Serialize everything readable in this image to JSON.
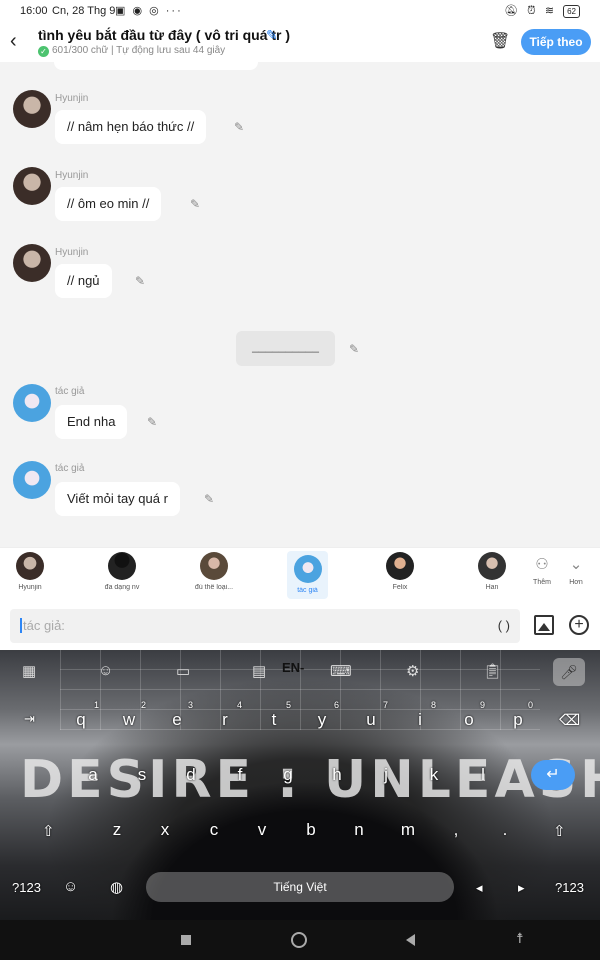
{
  "status_bar": {
    "time": "16:00",
    "date": "Cn, 28 Thg 9",
    "left_icons": "▣ ◉ ◎ ···",
    "right_icons": [
      "bell-off",
      "alarm",
      "wifi"
    ],
    "battery": "62"
  },
  "header": {
    "title": "tình yêu bắt đầu từ đây ( vô tri quá tr )",
    "subtitle": "601/300 chữ | Tự động lưu sau 44 giây",
    "next_label": "Tiếp theo"
  },
  "messages": [
    {
      "sender": "Hyunjin",
      "text": "// nâm hẹn báo thức //"
    },
    {
      "sender": "Hyunjin",
      "text": "// ôm eo min //"
    },
    {
      "sender": "Hyunjin",
      "text": "// ngủ"
    },
    {
      "sender": "",
      "text": "__________"
    },
    {
      "sender": "tác giả",
      "text": "End nha"
    },
    {
      "sender": "tác giả",
      "text": "Viết mỏi tay quá r"
    }
  ],
  "characters": [
    {
      "name": "Hyunjin"
    },
    {
      "name": "đa dạng nv"
    },
    {
      "name": "đủ thể loại..."
    },
    {
      "name": "tác giả",
      "selected": true
    },
    {
      "name": "Felix"
    },
    {
      "name": "Han"
    }
  ],
  "char_actions": {
    "more": "Thêm",
    "less": "Hơn"
  },
  "input": {
    "placeholder": "tác giả:",
    "paren": "( )"
  },
  "keyboard": {
    "banner": "DESIRE : UNLEASH",
    "logo": "EN-",
    "row1": [
      "q",
      "w",
      "e",
      "r",
      "t",
      "y",
      "u",
      "i",
      "o",
      "p"
    ],
    "row1_nums": [
      "1",
      "2",
      "3",
      "4",
      "5",
      "6",
      "7",
      "8",
      "9",
      "0"
    ],
    "row2": [
      "a",
      "s",
      "d",
      "f",
      "g",
      "h",
      "j",
      "k",
      "l"
    ],
    "row3": [
      "z",
      "x",
      "c",
      "v",
      "b",
      "n",
      "m",
      ",",
      "."
    ],
    "left_func": "?123",
    "right_func": "?123",
    "space_label": "Tiếng Việt",
    "tab_glyph": "⇥",
    "backspace_glyph": "⌫",
    "shift_glyph": "⇧",
    "enter_glyph": "↵",
    "emoji_glyph": "☺",
    "globe_glyph": "◍",
    "left_arrow": "◂",
    "right_arrow": "▸"
  },
  "colors": {
    "accent": "#4a9df5",
    "check": "#4cc36f"
  }
}
